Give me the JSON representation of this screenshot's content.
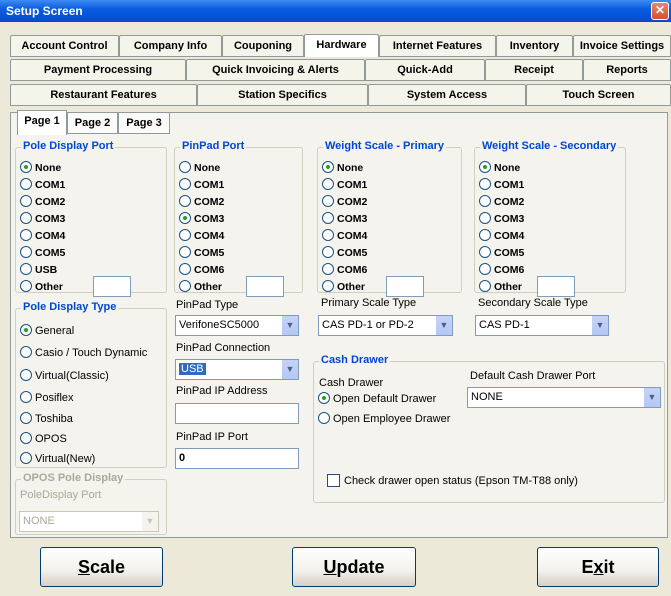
{
  "window": {
    "title": "Setup Screen",
    "close_glyph": "✕"
  },
  "tabs": {
    "row1": [
      "Account Control",
      "Company Info",
      "Couponing",
      "Hardware",
      "Internet Features",
      "Inventory",
      "Invoice Settings"
    ],
    "row2": [
      "Payment Processing",
      "Quick Invoicing & Alerts",
      "Quick-Add",
      "Receipt",
      "Reports"
    ],
    "row3": [
      "Restaurant Features",
      "Station Specifics",
      "System Access",
      "Touch Screen"
    ],
    "active": "Hardware"
  },
  "pages": [
    "Page 1",
    "Page 2",
    "Page 3"
  ],
  "pole_display_port": {
    "title": "Pole Display Port",
    "options": [
      "None",
      "COM1",
      "COM2",
      "COM3",
      "COM4",
      "COM5",
      "USB",
      "Other"
    ],
    "selected": "None"
  },
  "pinpad_port": {
    "title": "PinPad Port",
    "options": [
      "None",
      "COM1",
      "COM2",
      "COM3",
      "COM4",
      "COM5",
      "COM6",
      "Other"
    ],
    "selected": "COM3"
  },
  "weight_primary": {
    "title": "Weight Scale - Primary",
    "options": [
      "None",
      "COM1",
      "COM2",
      "COM3",
      "COM4",
      "COM5",
      "COM6",
      "Other"
    ],
    "selected": "None",
    "type_label": "Primary Scale Type",
    "type_value": "CAS PD-1 or PD-2"
  },
  "weight_secondary": {
    "title": "Weight Scale - Secondary",
    "options": [
      "None",
      "COM1",
      "COM2",
      "COM3",
      "COM4",
      "COM5",
      "COM6",
      "Other"
    ],
    "selected": "None",
    "type_label": "Secondary Scale Type",
    "type_value": "CAS PD-1"
  },
  "pole_display_type": {
    "title": "Pole Display Type",
    "options": [
      "General",
      "Casio / Touch Dynamic",
      "Virtual(Classic)",
      "Posiflex",
      "Toshiba",
      "OPOS",
      "Virtual(New)"
    ],
    "selected": "General"
  },
  "opos_pole_display": {
    "title": "OPOS Pole Display",
    "port_label": "PoleDisplay Port",
    "port_value": "NONE"
  },
  "pinpad": {
    "type_label": "PinPad Type",
    "type_value": "VerifoneSC5000",
    "connection_label": "PinPad Connection",
    "connection_value": "USB",
    "ip_label": "PinPad IP Address",
    "ip_value": "",
    "port_label": "PinPad IP Port",
    "port_value": "0"
  },
  "cash_drawer": {
    "title": "Cash Drawer",
    "label": "Cash Drawer",
    "options": [
      "Open Default Drawer",
      "Open Employee Drawer"
    ],
    "selected": "Open Default Drawer",
    "default_port_label": "Default Cash Drawer Port",
    "default_port_value": "NONE",
    "check_label": "Check drawer open status (Epson TM-T88 only)",
    "check_value": false
  },
  "buttons": {
    "scale": {
      "label": "Scale",
      "accel": "S",
      "rest": "cale"
    },
    "update": {
      "label": "Update",
      "accel": "U",
      "rest": "pdate"
    },
    "exit": {
      "label": "Exit",
      "pre": "E",
      "accel": "x",
      "rest": "it"
    }
  },
  "colors": {
    "title_bar": "#0350D6",
    "group_title": "#0046D5",
    "selected_radio": "#21A121",
    "highlight": "#316AC5"
  },
  "icons": {
    "close": "close-icon",
    "dropdown": "chevron-down-icon"
  }
}
